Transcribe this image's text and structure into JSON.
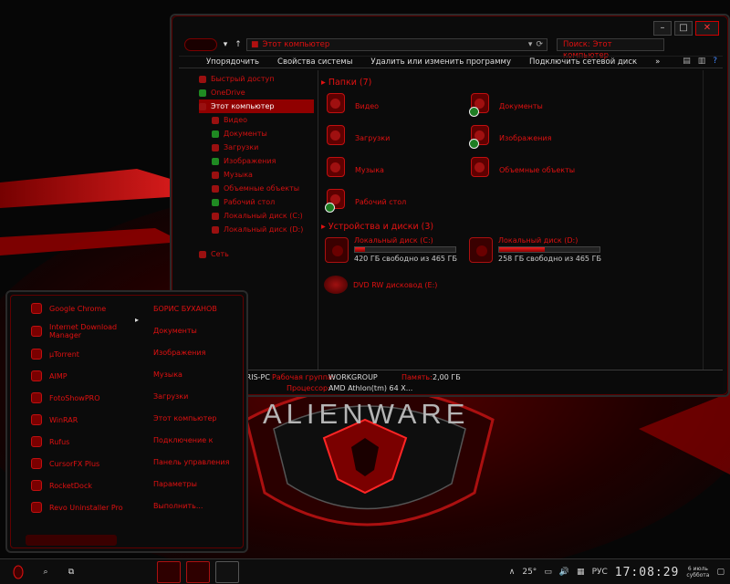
{
  "desktop": {
    "brand": "ALIENWARE"
  },
  "explorer": {
    "window_controls": {
      "minimize": "–",
      "maximize": "□",
      "close": "✕"
    },
    "address": "Этот компьютер",
    "search_placeholder": "Поиск: Этот компьютер",
    "commands": [
      "Упорядочить",
      "Свойства системы",
      "Удалить или изменить программу",
      "Подключить сетевой диск",
      "»"
    ],
    "nav": [
      {
        "label": "Быстрый доступ",
        "level": 0
      },
      {
        "label": "OneDrive",
        "level": 0
      },
      {
        "label": "Этот компьютер",
        "level": 0,
        "selected": true
      },
      {
        "label": "Видео",
        "level": 1
      },
      {
        "label": "Документы",
        "level": 1
      },
      {
        "label": "Загрузки",
        "level": 1
      },
      {
        "label": "Изображения",
        "level": 1
      },
      {
        "label": "Музыка",
        "level": 1
      },
      {
        "label": "Объемные объекты",
        "level": 1
      },
      {
        "label": "Рабочий стол",
        "level": 1
      },
      {
        "label": "Локальный диск (C:)",
        "level": 1
      },
      {
        "label": "Локальный диск (D:)",
        "level": 1
      },
      {
        "label": "Сеть",
        "level": 0
      }
    ],
    "folders_header": "Папки (7)",
    "folders": [
      "Видео",
      "Документы",
      "Загрузки",
      "Изображения",
      "Музыка",
      "Объемные объекты",
      "Рабочий стол"
    ],
    "devices_header": "Устройства и диски (3)",
    "drives": [
      {
        "name": "Локальный диск (C:)",
        "free": "420 ГБ свободно из 465 ГБ",
        "used_fraction": 0.1
      },
      {
        "name": "Локальный диск (D:)",
        "free": "258 ГБ свободно из 465 ГБ",
        "used_fraction": 0.45
      }
    ],
    "dvd": "DVD RW дисковод (E:)",
    "details": {
      "pc_name": "BORIS-PC",
      "workgroup_label": "Рабочая группа:",
      "workgroup_value": "WORKGROUP",
      "memory_label": "Память:",
      "memory_value": "2,00 ГБ",
      "cpu_label": "Процессор:",
      "cpu_value": "AMD Athlon(tm) 64 X..."
    }
  },
  "start_menu": {
    "programs": [
      "Google Chrome",
      "Internet Download Manager",
      "µTorrent",
      "AIMP",
      "FotoShowPRO",
      "WinRAR",
      "Rufus",
      "CursorFX Plus",
      "RocketDock",
      "Revo Uninstaller Pro"
    ],
    "places": [
      "БОРИС БУХАНОВ",
      "Документы",
      "Изображения",
      "Музыка",
      "Загрузки",
      "Этот компьютер",
      "Подключение к",
      "Панель управления",
      "Параметры",
      "Выполнить..."
    ]
  },
  "taskbar": {
    "language": "РУС",
    "clock": "17:08:29",
    "date_line1": "6 июль",
    "date_line2": "суббота",
    "tray_temp": "25°"
  }
}
